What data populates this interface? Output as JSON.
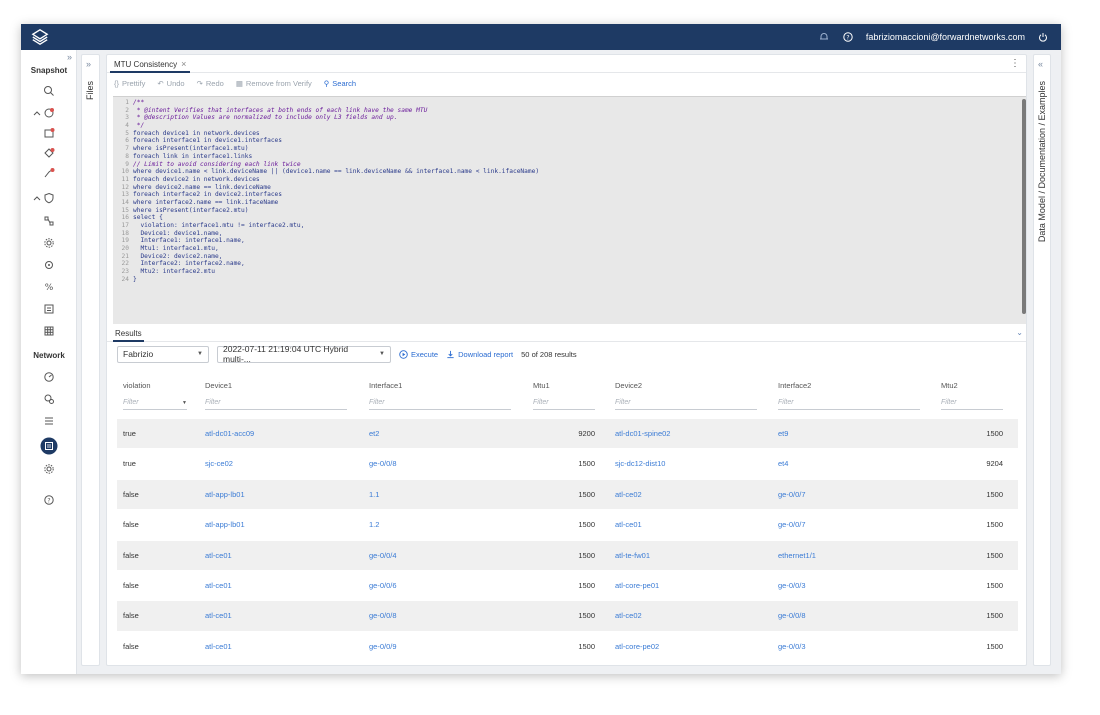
{
  "topbar": {
    "user_email": "fabriziomaccioni@forwardnetworks.com"
  },
  "leftnav": {
    "snapshot_label": "Snapshot",
    "network_label": "Network"
  },
  "files_label": "Files",
  "right_panel_label": "Data Model / Documentation / Examples",
  "editor_tab": {
    "label": "MTU Consistency"
  },
  "toolbar": {
    "prettify": "Prettify",
    "undo": "Undo",
    "redo": "Redo",
    "remove_from_verify": "Remove from Verify",
    "search": "Search"
  },
  "code": [
    "/**",
    " * @intent Verifies that interfaces at both ends of each link have the same MTU",
    " * @description Values are normalized to include only L3 fields and up.",
    " */",
    "foreach device1 in network.devices",
    "foreach interface1 in device1.interfaces",
    "where isPresent(interface1.mtu)",
    "foreach link in interface1.links",
    "// Limit to avoid considering each link twice",
    "where device1.name < link.deviceName || (device1.name == link.deviceName && interface1.name < link.ifaceName)",
    "foreach device2 in network.devices",
    "where device2.name == link.deviceName",
    "foreach interface2 in device2.interfaces",
    "where interface2.name == link.ifaceName",
    "where isPresent(interface2.mtu)",
    "select {",
    "  violation: interface1.mtu != interface2.mtu,",
    "  Device1: device1.name,",
    "  Interface1: interface1.name,",
    "  Mtu1: interface1.mtu,",
    "  Device2: device2.name,",
    "  Interface2: interface2.name,",
    "  Mtu2: interface2.mtu",
    "}"
  ],
  "results": {
    "tab_label": "Results",
    "network_select": "Fabrizio",
    "snapshot_select": "2022-07-11 21:19:04 UTC Hybrid multi-...",
    "execute": "Execute",
    "download": "Download report",
    "count": "50 of 208 results",
    "filter_placeholder": "Filter",
    "columns": [
      "violation",
      "Device1",
      "Interface1",
      "Mtu1",
      "Device2",
      "Interface2",
      "Mtu2"
    ],
    "rows": [
      [
        "true",
        "atl-dc01-acc09",
        "et2",
        "9200",
        "atl-dc01-spine02",
        "et9",
        "1500"
      ],
      [
        "true",
        "sjc-ce02",
        "ge-0/0/8",
        "1500",
        "sjc-dc12-dist10",
        "et4",
        "9204"
      ],
      [
        "false",
        "atl-app-lb01",
        "1.1",
        "1500",
        "atl-ce02",
        "ge-0/0/7",
        "1500"
      ],
      [
        "false",
        "atl-app-lb01",
        "1.2",
        "1500",
        "atl-ce01",
        "ge-0/0/7",
        "1500"
      ],
      [
        "false",
        "atl-ce01",
        "ge-0/0/4",
        "1500",
        "atl-te-fw01",
        "ethernet1/1",
        "1500"
      ],
      [
        "false",
        "atl-ce01",
        "ge-0/0/6",
        "1500",
        "atl-core-pe01",
        "ge-0/0/3",
        "1500"
      ],
      [
        "false",
        "atl-ce01",
        "ge-0/0/8",
        "1500",
        "atl-ce02",
        "ge-0/0/8",
        "1500"
      ],
      [
        "false",
        "atl-ce01",
        "ge-0/0/9",
        "1500",
        "atl-core-pe02",
        "ge-0/0/3",
        "1500"
      ]
    ]
  },
  "colors": {
    "topbar": "#1e3a64",
    "link": "#3a7bd5",
    "accent": "#2b6cd1"
  }
}
